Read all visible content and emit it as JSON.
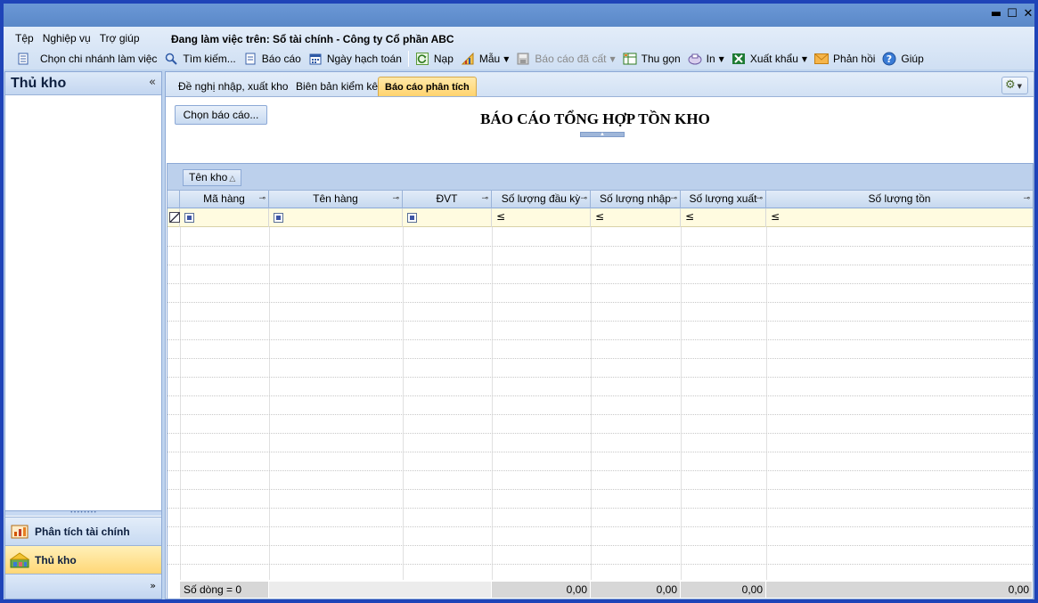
{
  "window": {
    "min_icon": "minimize-icon",
    "max_icon": "maximize-icon",
    "close_icon": "close-icon",
    "min_glyph": "▬",
    "max_glyph": "☐",
    "close_glyph": "✕"
  },
  "menu": {
    "items": [
      "Tệp",
      "Nghiệp vụ",
      "Trợ giúp"
    ],
    "working_on": "Đang làm việc trên: Sổ tài chính - Công ty Cổ phần ABC"
  },
  "toolbar": {
    "choose_branch": "Chọn chi nhánh làm việc",
    "search": "Tìm kiếm...",
    "report": "Báo cáo",
    "posting_date": "Ngày hạch toán",
    "load": "Nạp",
    "template": "Mẫu",
    "saved_reports": "Báo cáo đã cất",
    "collapse": "Thu gọn",
    "print": "In",
    "export": "Xuất khẩu",
    "feedback": "Phản hồi",
    "help": "Giúp"
  },
  "left_panel": {
    "title": "Thủ kho",
    "collapse_glyph": "«",
    "nav": [
      {
        "label": "Phân tích tài chính",
        "icon": "financial-analysis-icon"
      },
      {
        "label": "Thủ kho",
        "icon": "warehouse-keeper-icon"
      }
    ],
    "more_glyph": "»"
  },
  "tabs": [
    {
      "label": "Đề nghị nhập, xuất kho",
      "active": false
    },
    {
      "label": "Biên bản kiểm kê",
      "active": false
    },
    {
      "label": "Báo cáo phân tích",
      "active": true
    }
  ],
  "report": {
    "choose_button": "Chọn báo cáo...",
    "title": "BÁO CÁO TỔNG HỢP TỒN KHO"
  },
  "grid": {
    "group_by": "Tên kho",
    "columns": [
      "Mã hàng",
      "Tên hàng",
      "ĐVT",
      "Số lượng đầu kỳ",
      "Số lượng nhập",
      "Số lượng xuất",
      "Số lượng tồn"
    ],
    "filter_le": "≤",
    "footer": {
      "row_count": "Số dòng = 0",
      "opening_total": "0,00",
      "import_total": "0,00",
      "export_total": "0,00",
      "closing_total": "0,00"
    }
  }
}
